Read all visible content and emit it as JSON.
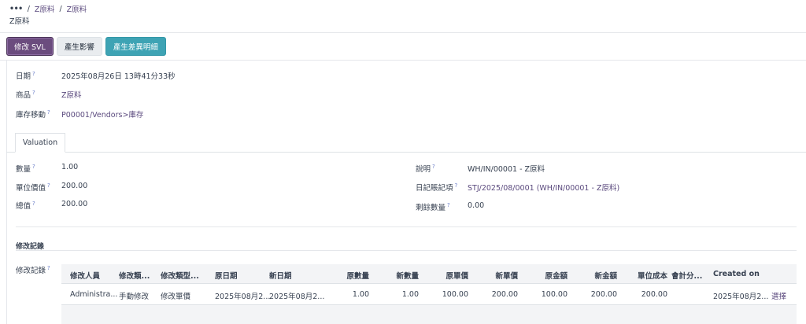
{
  "breadcrumb": {
    "more": "•••",
    "sep1": "/",
    "item1": "Z原料",
    "sep2": "/",
    "item2": "Z原料"
  },
  "page_title": "Z原料",
  "buttons": {
    "edit_svl": "修改 SVL",
    "impact": "產生影響",
    "diff_detail": "產生差異明細"
  },
  "header_fields": {
    "date": {
      "label": "日期",
      "help": "?",
      "value": "2025年08月26日 13時41分33秒"
    },
    "product": {
      "label": "商品",
      "help": "?",
      "value": "Z原料"
    },
    "stock_move": {
      "label": "庫存移動",
      "help": "?",
      "value": "P00001/Vendors>庫存"
    }
  },
  "tabs": {
    "valuation": "Valuation"
  },
  "valuation": {
    "quantity": {
      "label": "數量",
      "help": "?",
      "value": "1.00"
    },
    "unit_value": {
      "label": "單位價值",
      "help": "?",
      "value": "200.00"
    },
    "total_value": {
      "label": "總值",
      "help": "?",
      "value": "200.00"
    },
    "description": {
      "label": "說明",
      "help": "?",
      "value": "WH/IN/00001 - Z原料"
    },
    "journal_entry": {
      "label": "日記賬記項",
      "help": "?",
      "value": "STJ/2025/08/0001 (WH/IN/00001 - Z原料)"
    },
    "remaining_qty": {
      "label": "剩餘數量",
      "help": "?",
      "value": "0.00"
    }
  },
  "history": {
    "section_title": "修改記錄",
    "field_label": "修改記錄",
    "help": "?",
    "columns": [
      "修改人員",
      "修改類...",
      "修改類型...",
      "原日期",
      "新日期",
      "原數量",
      "新數量",
      "原單價",
      "新單價",
      "原金額",
      "新金額",
      "單位成本",
      "會計分...",
      "Created on"
    ],
    "rows": [
      [
        "Administra...",
        "手動修改",
        "修改單價",
        "2025年08月2...",
        "2025年08月2...",
        "1.00",
        "1.00",
        "100.00",
        "200.00",
        "100.00",
        "200.00",
        "200.00",
        "",
        "2025年08月2..."
      ]
    ],
    "row_action": "選擇"
  },
  "colors": {
    "primary": "#6b4c7e",
    "info": "#3ea3b4",
    "link": "#5b4a7e"
  }
}
